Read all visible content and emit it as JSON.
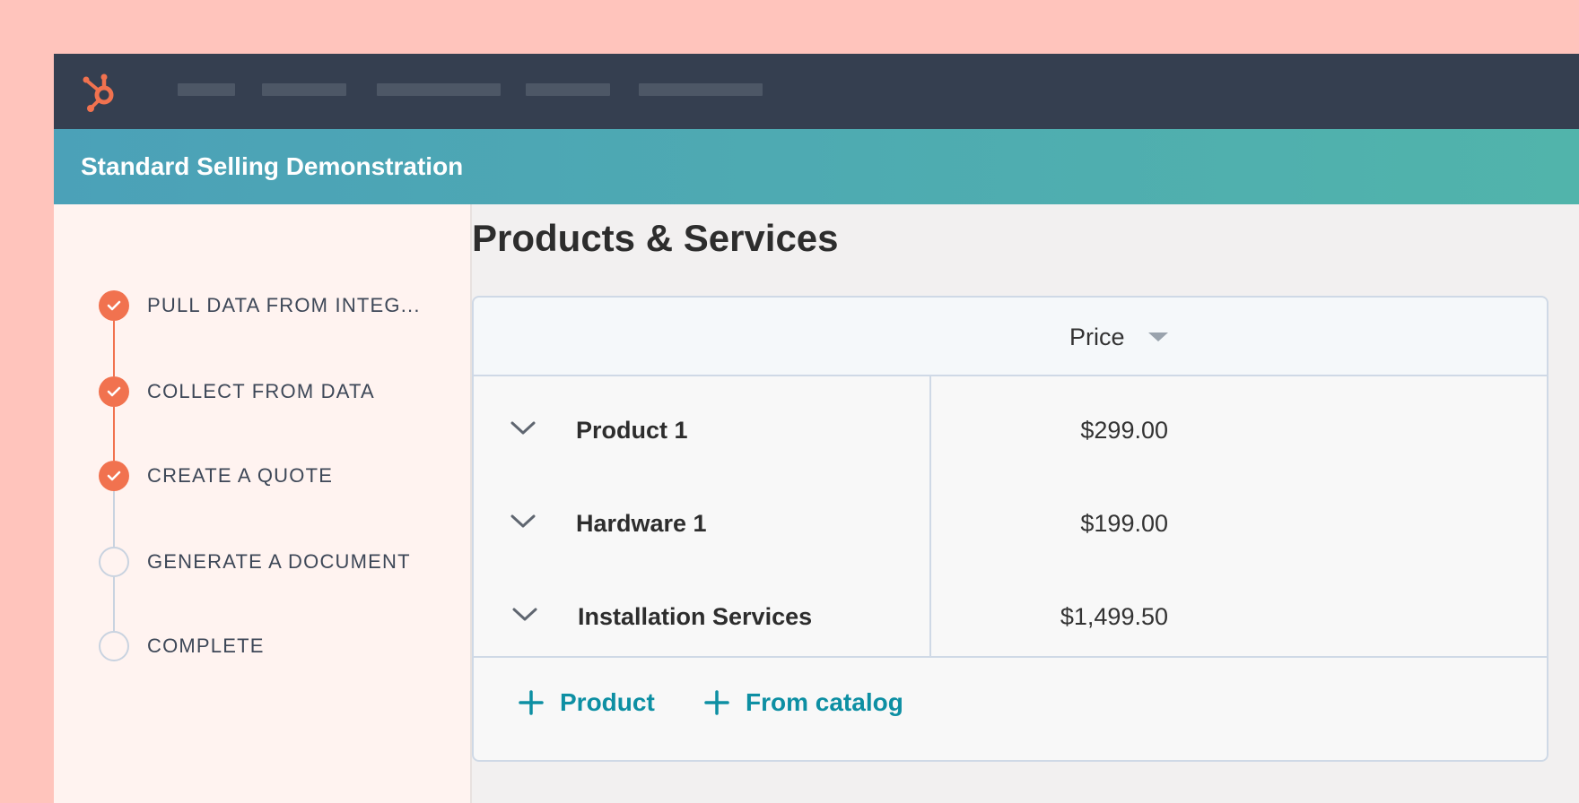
{
  "app": {
    "brand_color": "#f1724f",
    "logo_icon": "hubspot-sprocket-icon",
    "nav_items": [
      "",
      "",
      "",
      "",
      ""
    ]
  },
  "banner": {
    "title": "Standard Selling Demonstration"
  },
  "steps": [
    {
      "label": "PULL DATA FROM INTEG...",
      "status": "complete"
    },
    {
      "label": "COLLECT FROM DATA",
      "status": "complete"
    },
    {
      "label": "CREATE A QUOTE",
      "status": "complete"
    },
    {
      "label": "GENERATE A DOCUMENT",
      "status": "incomplete"
    },
    {
      "label": "COMPLETE",
      "status": "incomplete"
    }
  ],
  "main": {
    "title": "Products & Services",
    "table": {
      "price_header": "Price",
      "rows": [
        {
          "name": "Product 1",
          "price": "$299.00"
        },
        {
          "name": "Hardware 1",
          "price": "$199.00"
        },
        {
          "name": "Installation Services",
          "price": "$1,499.50"
        }
      ]
    },
    "actions": {
      "add_product_label": "Product",
      "add_from_catalog_label": "From catalog"
    }
  }
}
